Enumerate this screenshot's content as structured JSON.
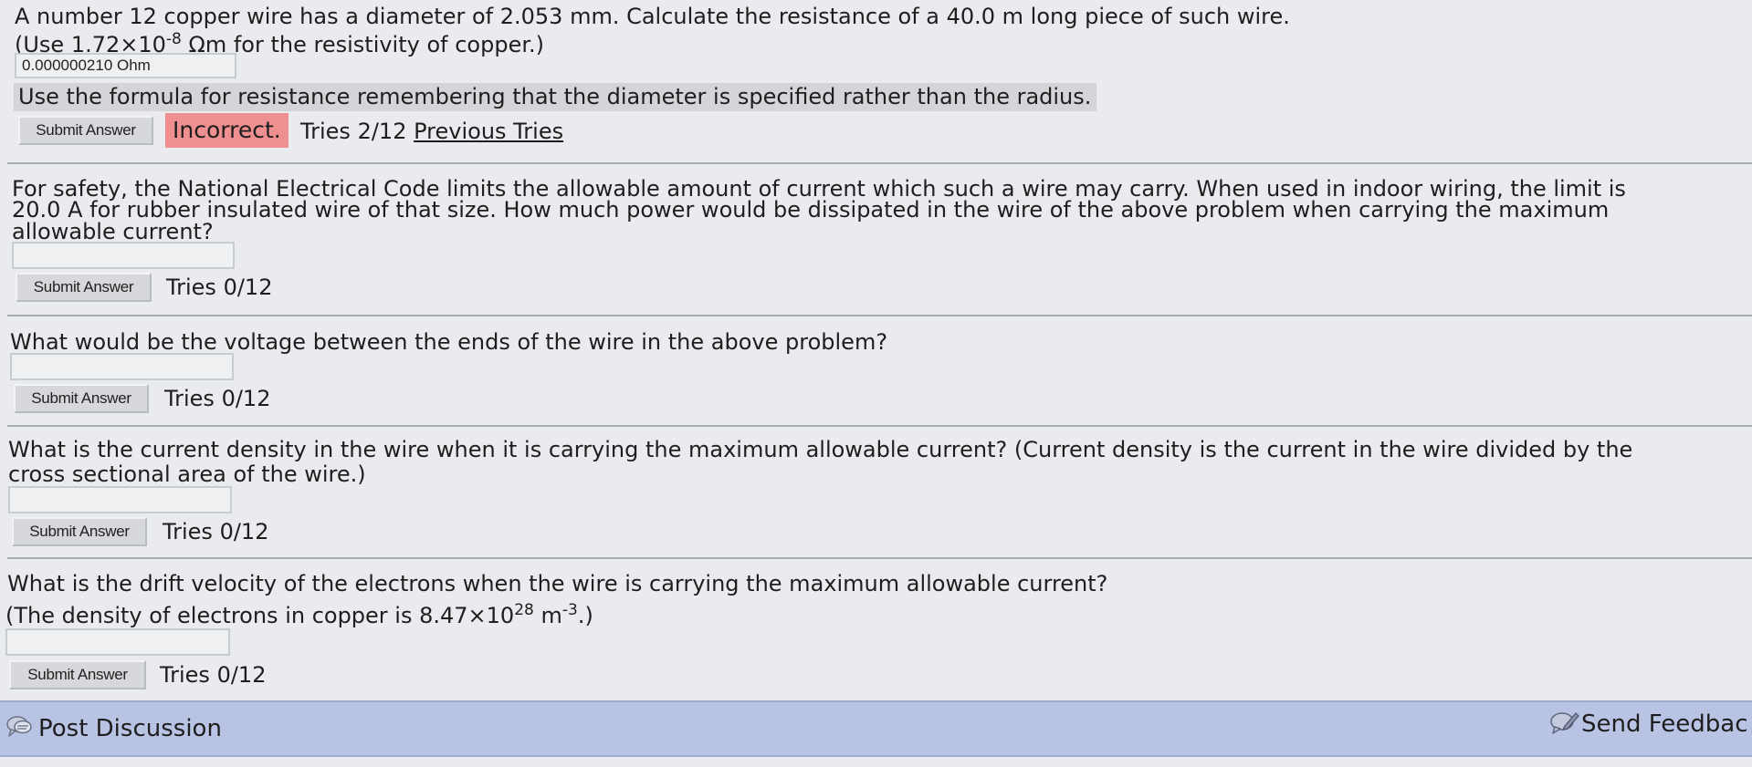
{
  "q1": {
    "line1": "A number 12 copper wire has a diameter of 2.053 mm. Calculate the resistance of a 40.0 m long piece of such wire.",
    "line2_pre": "(Use 1.72×10",
    "line2_exp": "-8",
    "line2_post": " Ωm for the resistivity of copper.)",
    "answer_value": "0.000000210 Ohm",
    "hint": "Use the formula for resistance remembering that the diameter is specified rather than the radius.",
    "submit_label": "Submit Answer",
    "status": "Incorrect.",
    "tries": "Tries 2/12",
    "previous_tries": "Previous Tries"
  },
  "q2": {
    "line1": "For safety, the National Electrical Code limits the allowable amount of current which such a wire may carry. When used in indoor wiring, the limit is",
    "line2": "20.0 A for rubber insulated wire of that size. How much power would be dissipated in the wire of the above problem when carrying the maximum",
    "line3": "allowable current?",
    "answer_value": "",
    "submit_label": "Submit Answer",
    "tries": "Tries 0/12"
  },
  "q3": {
    "line1": "What would be the voltage between the ends of the wire in the above problem?",
    "answer_value": "",
    "submit_label": "Submit Answer",
    "tries": "Tries 0/12"
  },
  "q4": {
    "line1": "What is the current density in the wire when it is carrying the maximum allowable current? (Current density is the current in the wire divided by the",
    "line2": "cross sectional area of the wire.)",
    "answer_value": "",
    "submit_label": "Submit Answer",
    "tries": "Tries 0/12"
  },
  "q5": {
    "line1": "What is the drift velocity of the electrons when the wire is carrying the maximum allowable current?",
    "line2_pre": "(The density of electrons in copper is 8.47×10",
    "line2_exp1": "28",
    "line2_mid": " m",
    "line2_exp2": "-3",
    "line2_post": ".)",
    "answer_value": "",
    "submit_label": "Submit Answer",
    "tries": "Tries 0/12"
  },
  "footer": {
    "post_discussion": "Post Discussion",
    "send_feedback": "Send Feedbac"
  },
  "icons": {
    "discussion": "discussion-bubbles-icon",
    "feedback": "feedback-pen-icon"
  },
  "colors": {
    "incorrect_bg": "#ef8f8f",
    "footer_bg": "#b9c3e4",
    "hint_bg": "#d3d5d8"
  }
}
